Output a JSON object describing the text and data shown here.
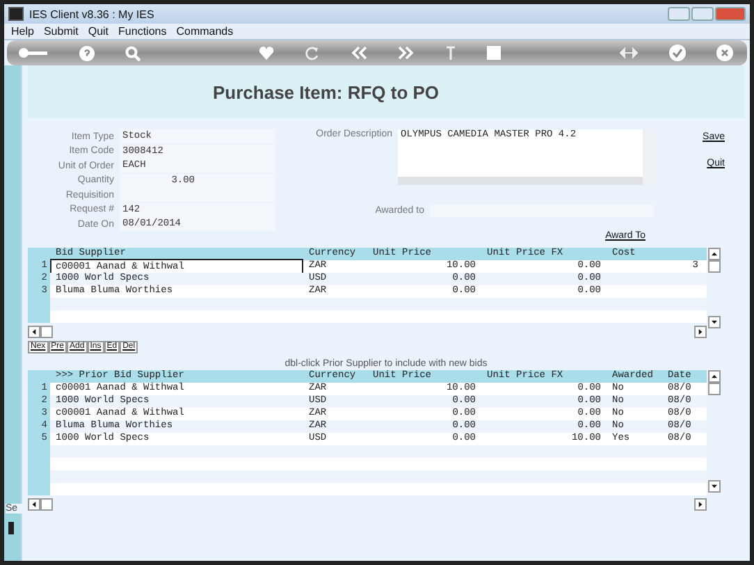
{
  "window": {
    "title": "IES Client v8.36 : My IES"
  },
  "menu": [
    "Help",
    "Submit",
    "Quit",
    "Functions",
    "Commands"
  ],
  "page_title": "Purchase Item: RFQ to PO",
  "fields": [
    {
      "label": "Item Type",
      "value": "Stock"
    },
    {
      "label": "Item Code",
      "value": "3008412"
    },
    {
      "label": "Unit of Order",
      "value": "EACH"
    },
    {
      "label": "Quantity",
      "value": "3.00",
      "kind": "number"
    },
    {
      "label": "Requisition"
    },
    {
      "label": "Request #",
      "value": "142"
    },
    {
      "label": "Date On",
      "value": "08/01/2014"
    }
  ],
  "order_description": {
    "label": "Order Description",
    "value": "OLYMPUS CAMEDIA MASTER PRO 4.2"
  },
  "awarded_to": {
    "label": "Awarded to"
  },
  "links": [
    "Save",
    "Quit"
  ],
  "award_link": "Award To",
  "bid_table": {
    "columns": [
      "Bid Supplier",
      "Currency",
      "Unit Price",
      "Unit Price FX",
      "Cost"
    ],
    "rows": [
      {
        "num": "1",
        "selected": true,
        "cells": [
          "c00001 Aanad & Withwal",
          "ZAR",
          "10.00",
          "0.00",
          "3"
        ]
      },
      {
        "num": "2",
        "selected": false,
        "cells": [
          "1000 World Specs",
          "USD",
          "0.00",
          "0.00"
        ]
      },
      {
        "num": "3",
        "selected": false,
        "cells": [
          "Bluma Bluma Worthies",
          "ZAR",
          "0.00",
          "0.00"
        ]
      }
    ]
  },
  "nav_buttons": [
    "Nex",
    "Pre",
    "Add",
    "Ins",
    "Ed",
    "Del"
  ],
  "hint": "dbl-click Prior Supplier to include with new bids",
  "prior_table": {
    "columns": [
      ">>> Prior Bid Supplier",
      "Currency",
      "Unit Price",
      "Unit Price FX",
      "Awarded",
      "Date"
    ],
    "rows": [
      {
        "num": "1",
        "cells": [
          "c00001 Aanad & Withwal",
          "ZAR",
          "10.00",
          "0.00",
          "No",
          "08/0"
        ]
      },
      {
        "num": "2",
        "cells": [
          "1000 World Specs",
          "USD",
          "0.00",
          "0.00",
          "No",
          "08/0"
        ]
      },
      {
        "num": "3",
        "cells": [
          "c00001 Aanad & Withwal",
          "ZAR",
          "0.00",
          "0.00",
          "No",
          "08/0"
        ]
      },
      {
        "num": "4",
        "cells": [
          "Bluma Bluma Worthies",
          "ZAR",
          "0.00",
          "0.00",
          "No",
          "08/0"
        ]
      },
      {
        "num": "5",
        "cells": [
          "1000 World Specs",
          "USD",
          "0.00",
          "10.00",
          "Yes",
          "08/0"
        ]
      }
    ]
  },
  "side_text": "Se"
}
